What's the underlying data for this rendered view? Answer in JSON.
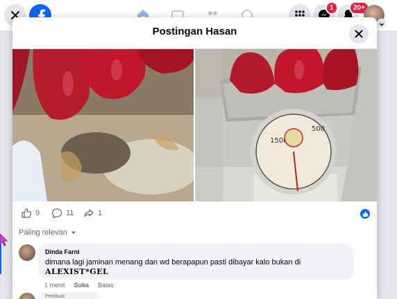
{
  "topbar": {
    "messenger_badge": "1",
    "notifications_badge": "20+"
  },
  "modal": {
    "title": "Postingan Hasan"
  },
  "reactions": {
    "likes": "9",
    "comments": "11",
    "shares": "1"
  },
  "comments_sort": {
    "label": "Paling relevan"
  },
  "comment": {
    "author": "Dinda Farni",
    "text": "dimana lagi jaminan menang dan wd berapapun pasti dibayar kalo bukan di",
    "text_bold": "ALEXIST*GEL",
    "time": "1 menit",
    "like_label": "Suka",
    "reply_label": "Balas"
  },
  "comment2": {
    "snippet": "Pembuat"
  },
  "colors": {
    "brand": "#0866ff",
    "badge": "#e41e3f"
  }
}
